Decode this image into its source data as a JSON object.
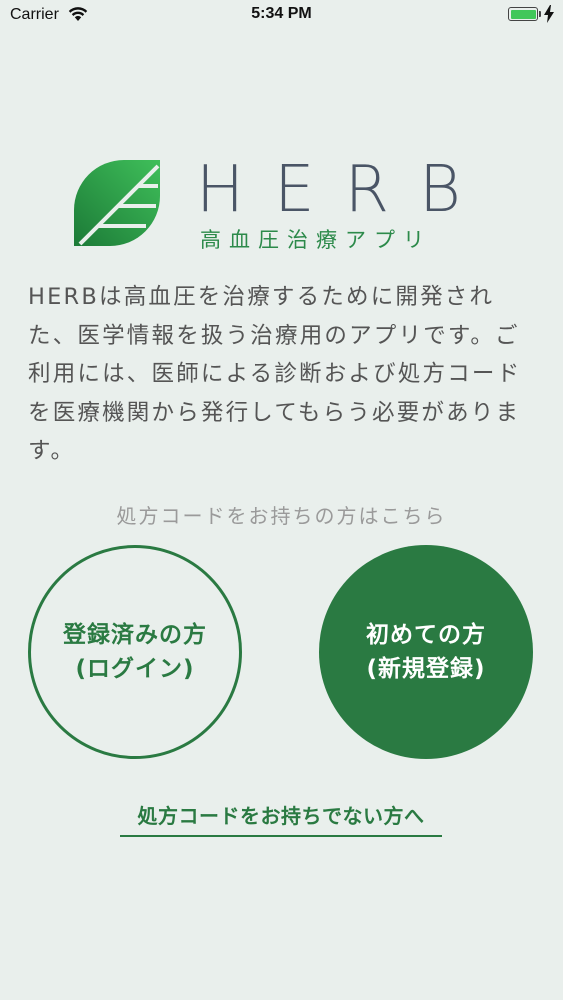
{
  "status_bar": {
    "carrier": "Carrier",
    "time": "5:34 PM",
    "battery_level": 1.0
  },
  "logo": {
    "wordmark": "HERB",
    "tagline": "高血圧治療アプリ"
  },
  "description": "HERBは高血圧を治療するために開発された、医学情報を扱う治療用のアプリです。ご利用には、医師による診断および処方コードを医療機関から発行してもらう必要があります。",
  "prompt": "処方コードをお持ちの方はこちら",
  "buttons": {
    "login": {
      "line1": "登録済みの方",
      "line2": "(ログイン)"
    },
    "register": {
      "line1": "初めての方",
      "line2": "(新規登録)"
    }
  },
  "no_code_link": "処方コードをお持ちでない方へ",
  "colors": {
    "background": "#e9efec",
    "brand_green": "#2a7a42",
    "leaf_green": "#22a040",
    "wordmark": "#4a5566"
  }
}
